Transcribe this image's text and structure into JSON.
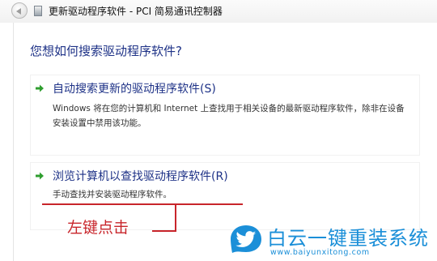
{
  "window": {
    "title": "更新驱动程序软件 - PCI 简易通讯控制器"
  },
  "main": {
    "heading": "您想如何搜索驱动程序软件?",
    "options": [
      {
        "title": "自动搜索更新的驱动程序软件(S)",
        "description": "Windows 将在您的计算机和 Internet 上查找用于相关设备的最新驱动程序软件，除非在设备安装设置中禁用该功能。",
        "icon": "green-arrow-icon"
      },
      {
        "title": "浏览计算机以查找驱动程序软件(R)",
        "description": "手动查找并安装驱动程序软件。",
        "icon": "green-arrow-icon"
      }
    ]
  },
  "annotation": {
    "label": "左键点击",
    "color": "#c8252b"
  },
  "watermark": {
    "name": "白云一键重装系统",
    "url": "www.baiyunxitong.com",
    "color": "#1b8fd8",
    "icon": "twitter-bird-logo"
  }
}
